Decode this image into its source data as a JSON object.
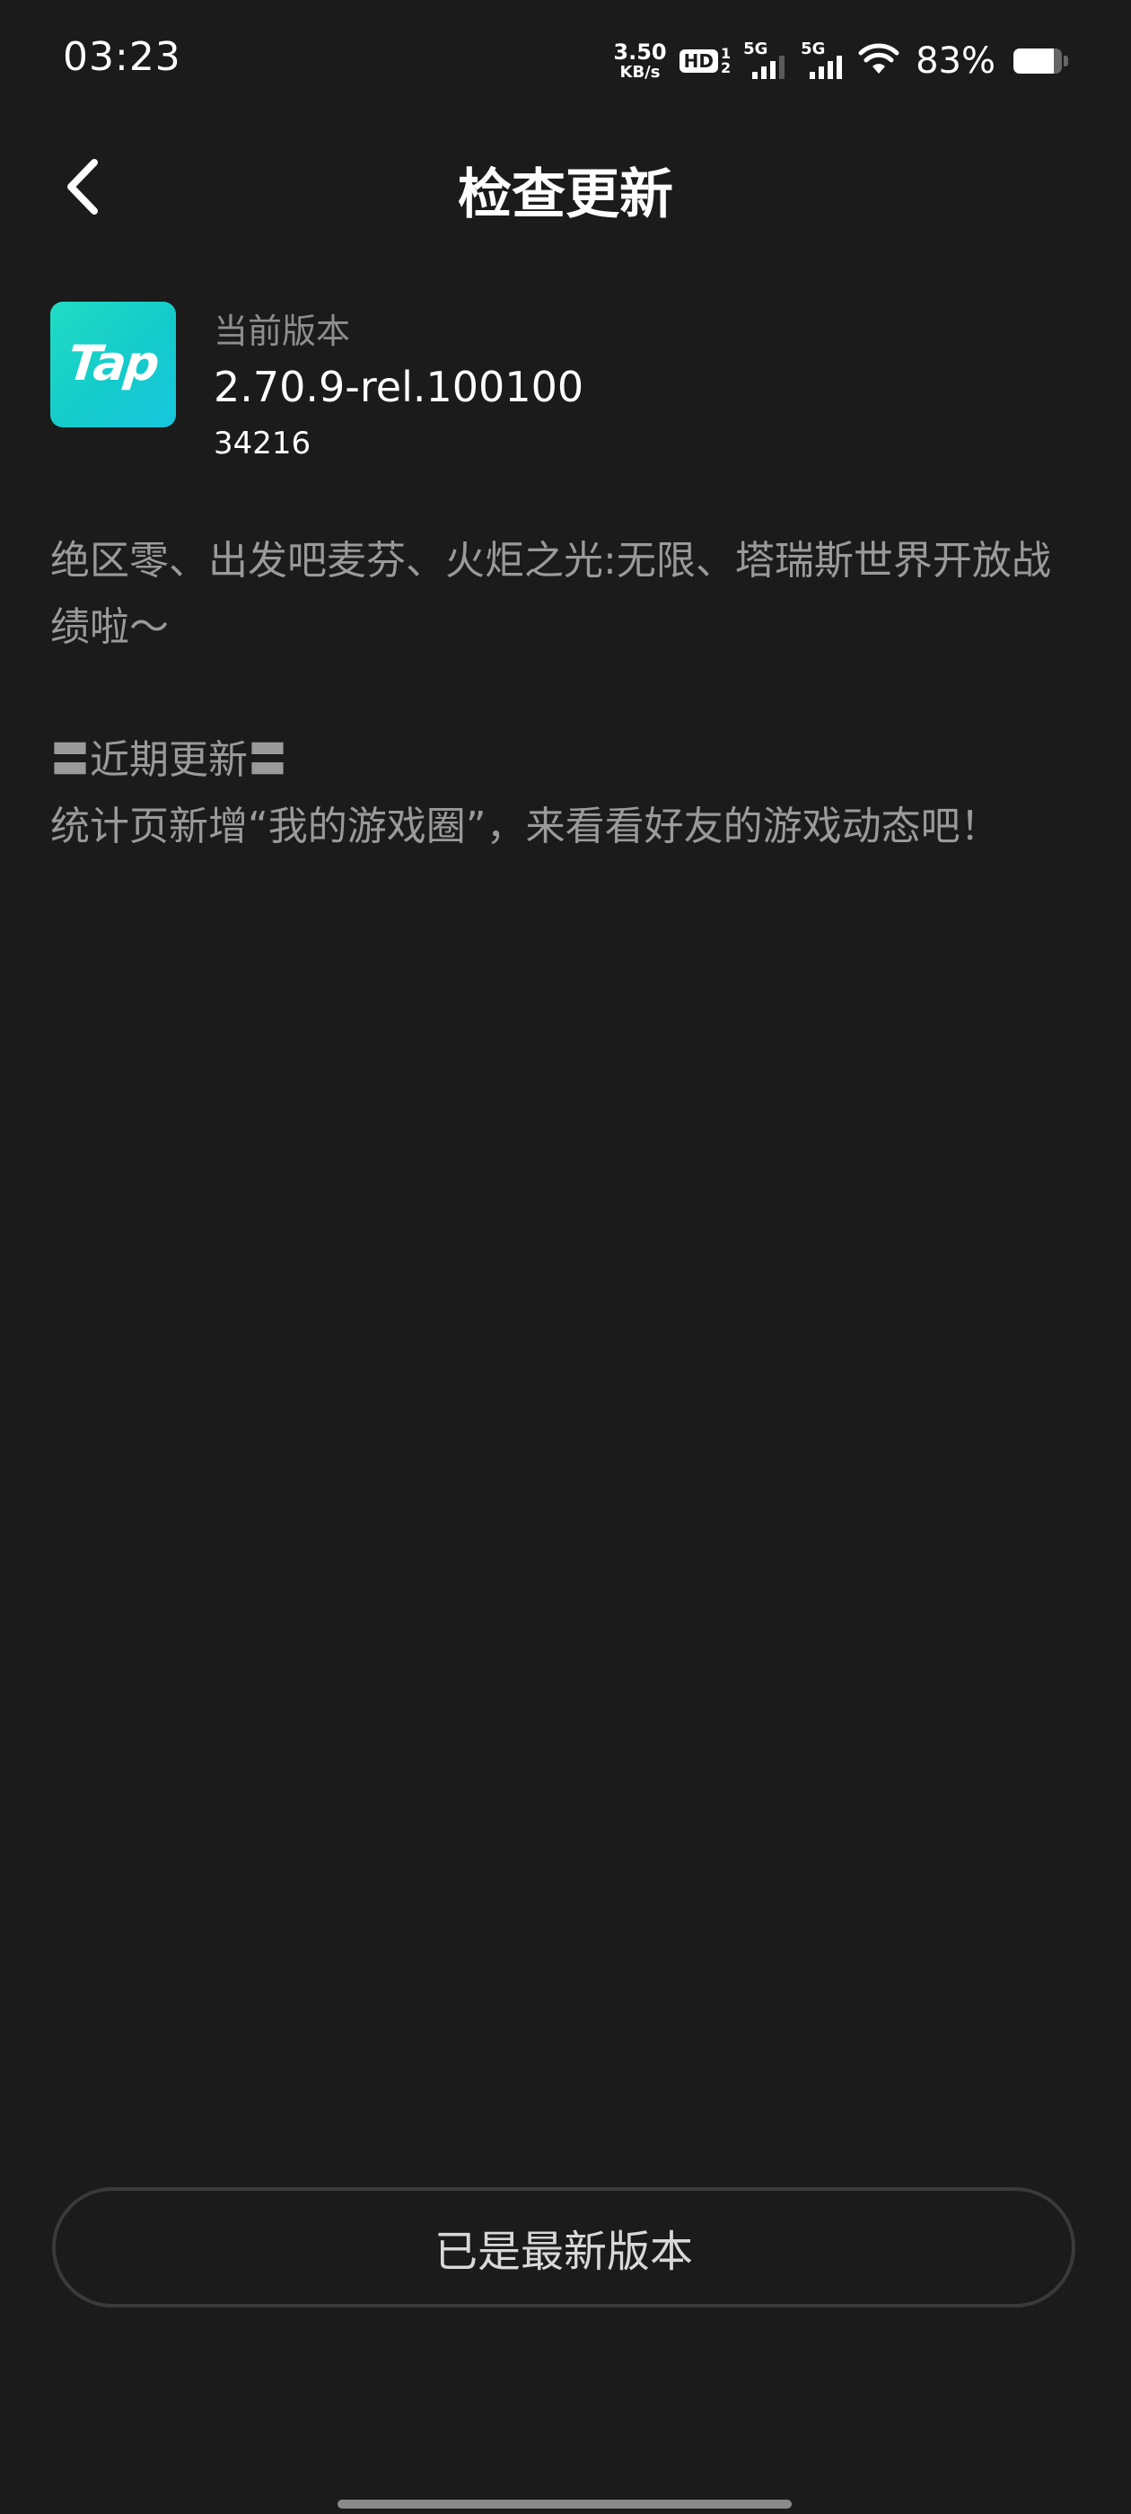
{
  "status_bar": {
    "time": "03:23",
    "net_speed_value": "3.50",
    "net_speed_unit": "KB/s",
    "hd_label": "HD",
    "hd_sub_top": "1",
    "hd_sub_bottom": "2",
    "sim1_label": "5G",
    "sim2_label": "5G",
    "battery_percent": "83%",
    "battery_level": 0.83
  },
  "header": {
    "title": "检查更新",
    "back_icon": "chevron-left-icon"
  },
  "app_info": {
    "logo_text": "Tap",
    "logo_colors": [
      "#21dcc4",
      "#18c6df"
    ],
    "version_label": "当前版本",
    "version": "2.70.9-rel.100100",
    "build": "34216"
  },
  "release_notes": {
    "paragraph1": "绝区零、出发吧麦芬、火炬之光:无限、塔瑞斯世界开放战绩啦～",
    "section_heading": "〓近期更新〓",
    "paragraph2": "统计页新增“我的游戏圈”，来看看好友的游戏动态吧！"
  },
  "footer": {
    "status_button_label": "已是最新版本"
  },
  "colors": {
    "background": "#1b1b1b",
    "primary_text": "#ffffff",
    "secondary_text": "#9a9a9a",
    "button_border": "#3a3a3a"
  }
}
